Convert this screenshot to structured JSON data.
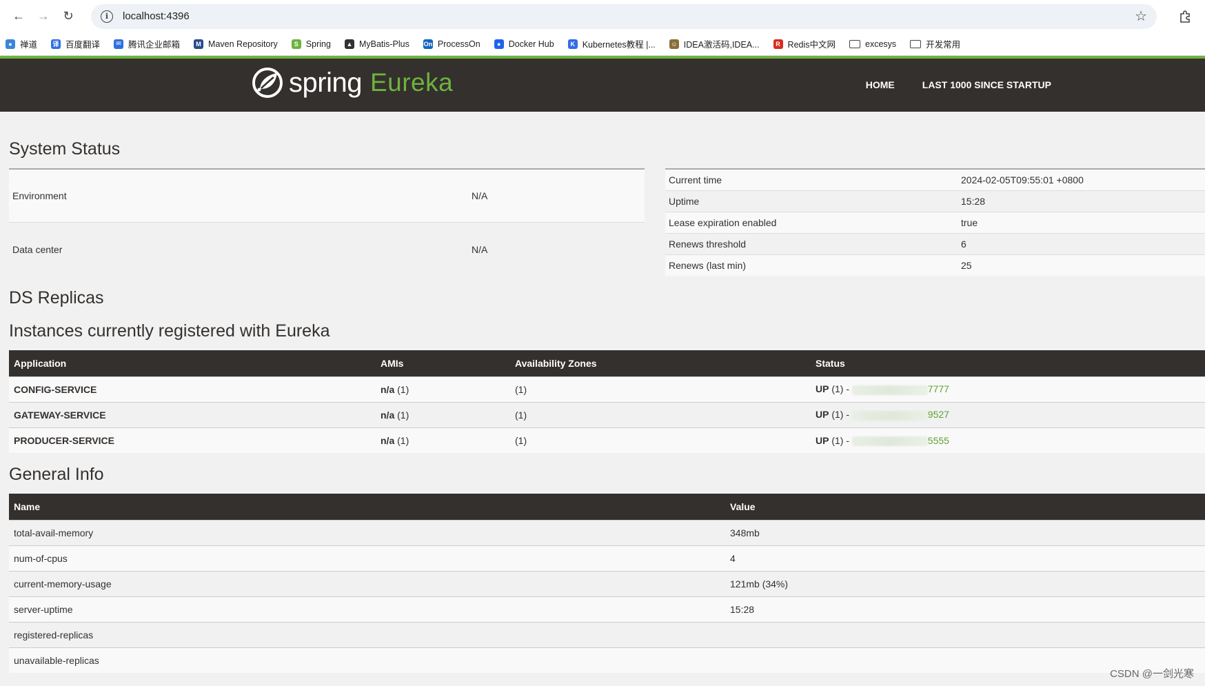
{
  "browser": {
    "url": "localhost:4396",
    "bookmarks": [
      {
        "label": "禅道",
        "color": "#3a86d8",
        "glyph": "●"
      },
      {
        "label": "百度翻译",
        "color": "#2f6fe0",
        "glyph": "译"
      },
      {
        "label": "腾讯企业邮箱",
        "color": "#2f6fe0",
        "glyph": "✉"
      },
      {
        "label": "Maven Repository",
        "color": "#2b4b8c",
        "glyph": "M"
      },
      {
        "label": "Spring",
        "color": "#6db33f",
        "glyph": "S"
      },
      {
        "label": "MyBatis-Plus",
        "color": "#333333",
        "glyph": "▲"
      },
      {
        "label": "ProcessOn",
        "color": "#1565c0",
        "glyph": "On"
      },
      {
        "label": "Docker Hub",
        "color": "#1d63ed",
        "glyph": "●"
      },
      {
        "label": "Kubernetes教程 |...",
        "color": "#326ce5",
        "glyph": "K"
      },
      {
        "label": "IDEA激活码,IDEA...",
        "color": "#8a6d3b",
        "glyph": "☺"
      },
      {
        "label": "Redis中文网",
        "color": "#d82c20",
        "glyph": "R"
      }
    ],
    "folders": [
      {
        "label": "excesys"
      },
      {
        "label": "开发常用"
      }
    ]
  },
  "navbar": {
    "brand_word": "spring",
    "brand_eureka": "Eureka",
    "home": "HOME",
    "last1000": "LAST 1000 SINCE STARTUP"
  },
  "system_status": {
    "title": "System Status",
    "left": [
      {
        "name": "Environment",
        "value": "N/A"
      },
      {
        "name": "Data center",
        "value": "N/A"
      }
    ],
    "right": [
      {
        "name": "Current time",
        "value": "2024-02-05T09:55:01 +0800"
      },
      {
        "name": "Uptime",
        "value": "15:28"
      },
      {
        "name": "Lease expiration enabled",
        "value": "true"
      },
      {
        "name": "Renews threshold",
        "value": "6"
      },
      {
        "name": "Renews (last min)",
        "value": "25"
      }
    ]
  },
  "ds_replicas": {
    "title": "DS Replicas"
  },
  "instances": {
    "title": "Instances currently registered with Eureka",
    "headers": [
      "Application",
      "AMIs",
      "Availability Zones",
      "Status"
    ],
    "rows": [
      {
        "app": "CONFIG-SERVICE",
        "ami": "n/a",
        "ami_count": "(1)",
        "zones": "(1)",
        "status": "UP",
        "status_count": "(1) -",
        "instance_suffix": ":7777"
      },
      {
        "app": "GATEWAY-SERVICE",
        "ami": "n/a",
        "ami_count": "(1)",
        "zones": "(1)",
        "status": "UP",
        "status_count": "(1) -",
        "instance_suffix": ":9527"
      },
      {
        "app": "PRODUCER-SERVICE",
        "ami": "n/a",
        "ami_count": "(1)",
        "zones": "(1)",
        "status": "UP",
        "status_count": "(1) -",
        "instance_suffix": ":5555"
      }
    ]
  },
  "general_info": {
    "title": "General Info",
    "headers": [
      "Name",
      "Value"
    ],
    "rows": [
      {
        "name": "total-avail-memory",
        "value": "348mb"
      },
      {
        "name": "num-of-cpus",
        "value": "4"
      },
      {
        "name": "current-memory-usage",
        "value": "121mb (34%)"
      },
      {
        "name": "server-uptime",
        "value": "15:28"
      },
      {
        "name": "registered-replicas",
        "value": ""
      },
      {
        "name": "unavailable-replicas",
        "value": ""
      }
    ]
  },
  "watermark": "CSDN @一剑光寒"
}
